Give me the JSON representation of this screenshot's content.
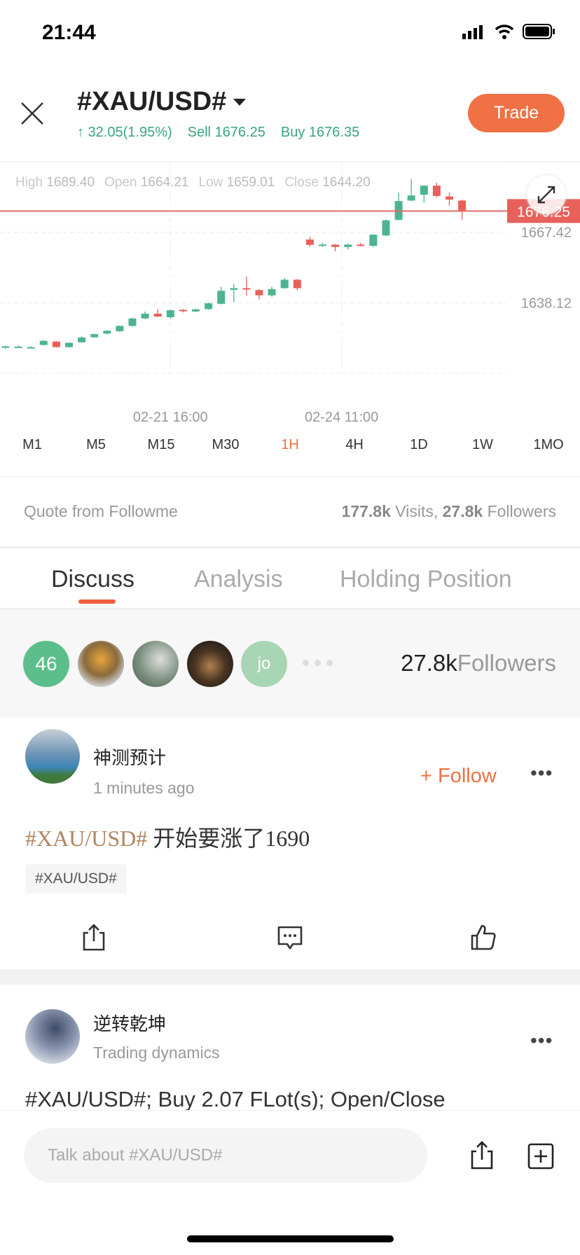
{
  "status_bar": {
    "time": "21:44"
  },
  "header": {
    "symbol": "#XAU/USD#",
    "change": "↑ 32.05(1.95%)",
    "sell_label": "Sell",
    "sell_price": "1676.25",
    "buy_label": "Buy",
    "buy_price": "1676.35",
    "trade_label": "Trade"
  },
  "colors": {
    "accent": "#ef7144",
    "up": "#4db48f",
    "down": "#e8605a",
    "price_line": "#e36b6b"
  },
  "chart_data": {
    "type": "candlestick",
    "ohlc_readout": {
      "high_label": "High",
      "high": "1689.40",
      "open_label": "Open",
      "open": "1664.21",
      "low_label": "Low",
      "low": "1659.01",
      "close_label": "Close",
      "close": "1644.20"
    },
    "y_ticks": [
      {
        "value": 1667.42,
        "label": "1667.42"
      },
      {
        "value": 1638.12,
        "label": "1638.12"
      }
    ],
    "ylim": [
      1608.82,
      1696.72
    ],
    "x_ticks": [
      {
        "index": 13,
        "label": "02-21 16:00"
      },
      {
        "index": 26.5,
        "label": "02-24 11:00"
      }
    ],
    "current_price": {
      "value": 1676.25,
      "label": "1676.25"
    },
    "grid": true,
    "candles": [
      [
        1619.5,
        1620.3,
        1619.0,
        1620.0
      ],
      [
        1619.9,
        1620.4,
        1619.5,
        1619.9
      ],
      [
        1619.7,
        1620.1,
        1619.2,
        1619.7
      ],
      [
        1620.6,
        1622.6,
        1620.3,
        1622.3
      ],
      [
        1622.0,
        1622.2,
        1619.5,
        1619.7
      ],
      [
        1619.7,
        1621.7,
        1619.5,
        1621.5
      ],
      [
        1621.7,
        1624.3,
        1621.5,
        1623.7
      ],
      [
        1623.8,
        1625.3,
        1623.6,
        1625.1
      ],
      [
        1625.3,
        1626.8,
        1625.0,
        1626.5
      ],
      [
        1626.3,
        1628.8,
        1626.0,
        1628.5
      ],
      [
        1628.5,
        1631.9,
        1628.2,
        1631.6
      ],
      [
        1631.6,
        1634.5,
        1631.3,
        1633.6
      ],
      [
        1633.6,
        1635.5,
        1632.2,
        1632.4
      ],
      [
        1632.1,
        1635.3,
        1631.6,
        1635.0
      ],
      [
        1635.2,
        1635.5,
        1634.1,
        1634.6
      ],
      [
        1634.5,
        1635.7,
        1634.2,
        1635.4
      ],
      [
        1635.5,
        1638.2,
        1635.2,
        1637.9
      ],
      [
        1637.7,
        1644.8,
        1637.4,
        1643.1
      ],
      [
        1643.5,
        1646.0,
        1638.5,
        1644.2
      ],
      [
        1644.2,
        1649.0,
        1641.0,
        1643.9
      ],
      [
        1643.4,
        1643.8,
        1639.5,
        1641.2
      ],
      [
        1641.2,
        1644.8,
        1640.6,
        1643.8
      ],
      [
        1644.2,
        1648.4,
        1644.0,
        1647.7
      ],
      [
        1647.7,
        1648.0,
        1643.3,
        1644.2
      ],
      [
        1664.4,
        1665.5,
        1661.5,
        1662.2
      ],
      [
        1662.3,
        1663.0,
        1661.3,
        1662.3
      ],
      [
        1662.3,
        1662.6,
        1659.5,
        1661.3
      ],
      [
        1661.3,
        1662.6,
        1660.3,
        1662.3
      ],
      [
        1662.3,
        1663.0,
        1661.6,
        1661.9
      ],
      [
        1661.8,
        1666.7,
        1661.3,
        1666.4
      ],
      [
        1666.1,
        1672.7,
        1665.8,
        1672.4
      ],
      [
        1672.6,
        1684.0,
        1672.3,
        1680.4
      ],
      [
        1680.6,
        1689.4,
        1680.3,
        1682.7
      ],
      [
        1683.0,
        1687.0,
        1679.7,
        1686.8
      ],
      [
        1686.8,
        1688.0,
        1682.0,
        1682.5
      ],
      [
        1682.3,
        1684.0,
        1678.5,
        1681.0
      ],
      [
        1680.6,
        1681.0,
        1672.6,
        1676.25
      ]
    ]
  },
  "timeframes": [
    {
      "label": "M1"
    },
    {
      "label": "M5"
    },
    {
      "label": "M15"
    },
    {
      "label": "M30"
    },
    {
      "label": "1H",
      "active": true
    },
    {
      "label": "4H"
    },
    {
      "label": "1D"
    },
    {
      "label": "1W"
    },
    {
      "label": "1MO"
    }
  ],
  "quote": {
    "source": "Quote from Followme",
    "visits": "177.8k",
    "visits_label": " Visits, ",
    "followers": "27.8k",
    "followers_label": " Followers"
  },
  "tabs": [
    {
      "label": "Discuss",
      "active": true
    },
    {
      "label": "Analysis"
    },
    {
      "label": "Holding Position"
    }
  ],
  "followers_strip": {
    "count_badge": "46",
    "initial_avatar": "jo",
    "total": "27.8k",
    "total_label": "Followers"
  },
  "posts": [
    {
      "author": "神测预计",
      "meta": "1 minutes ago",
      "follow_label": "+ Follow",
      "tag_text": "#XAU/USD#",
      "body": " 开始要涨了1690",
      "tag_chip": "#XAU/USD#"
    },
    {
      "author": "逆转乾坤",
      "meta": "Trading dynamics",
      "body": "#XAU/USD#; Buy 2.07 FLot(s); Open/Close"
    }
  ],
  "bottom_bar": {
    "placeholder": "Talk about #XAU/USD#"
  }
}
